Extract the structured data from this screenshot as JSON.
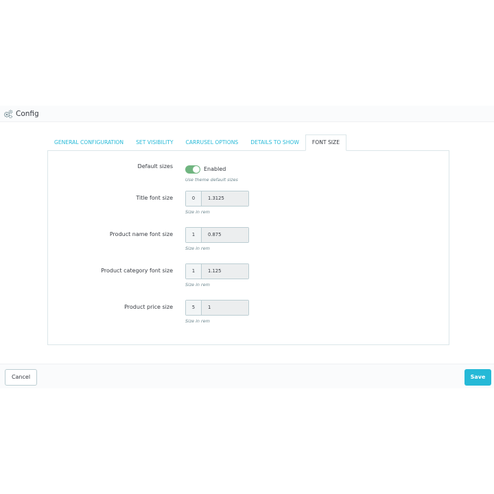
{
  "header": {
    "icon": "gears-icon",
    "title": "Config"
  },
  "tabs": [
    {
      "label": "GENERAL CONFIGURATION",
      "active": false
    },
    {
      "label": "SET VISIBILITY",
      "active": false
    },
    {
      "label": "CARRUSEL OPTIONS",
      "active": false
    },
    {
      "label": "DETAILS TO SHOW",
      "active": false
    },
    {
      "label": "FONT SIZE",
      "active": true
    }
  ],
  "form": {
    "default_sizes": {
      "label": "Default sizes",
      "switch_state": "on",
      "switch_label": "Enabled",
      "help": "Use theme default sizes"
    },
    "fields": [
      {
        "label": "Title font size",
        "prefix": "0",
        "value": "1.3125",
        "help": "Size in rem"
      },
      {
        "label": "Product name font size",
        "prefix": "1",
        "value": "0.875",
        "help": "Size in rem"
      },
      {
        "label": "Product category font size",
        "prefix": "1",
        "value": "1.125",
        "help": "Size in rem"
      },
      {
        "label": "Product price size",
        "prefix": "5",
        "value": "1",
        "help": "Size in rem"
      }
    ]
  },
  "footer": {
    "cancel_label": "Cancel",
    "save_label": "Save"
  },
  "colors": {
    "accent": "#25b9d7",
    "switch_on": "#70b580"
  }
}
